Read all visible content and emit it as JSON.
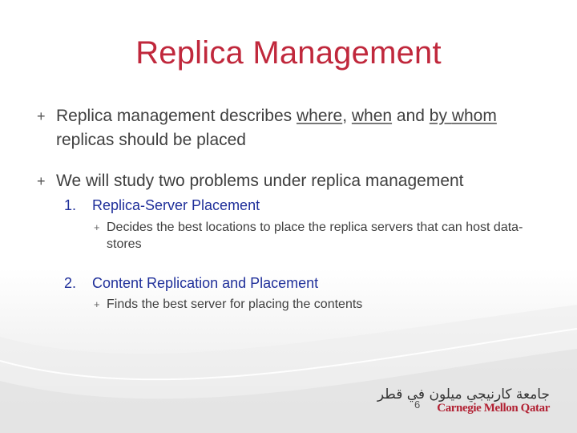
{
  "slide": {
    "title": "Replica Management",
    "bullets": [
      {
        "mark": "+",
        "parts": [
          "Replica management describes ",
          "where",
          ", ",
          "when",
          " and ",
          "by",
          " ",
          "whom",
          " replicas should be placed"
        ]
      },
      {
        "mark": "+",
        "text": "We will study two problems under replica management"
      }
    ],
    "numbered": [
      {
        "num": "1.",
        "label": "Replica-Server Placement",
        "sub_mark": "+",
        "sub": "Decides the best locations to place the replica servers that can host data-stores"
      },
      {
        "num": "2.",
        "label": "Content Replication and Placement",
        "sub_mark": "+",
        "sub": "Finds the best server for placing the contents"
      }
    ],
    "page_number": "6"
  },
  "logo": {
    "arabic": "جامعة كارنيجي ميلون في قطر",
    "english": "Carnegie Mellon Qatar"
  },
  "colors": {
    "title": "#c0283c",
    "body_text": "#404040",
    "numbered_text": "#1f2f9a",
    "logo_red": "#b22234"
  }
}
